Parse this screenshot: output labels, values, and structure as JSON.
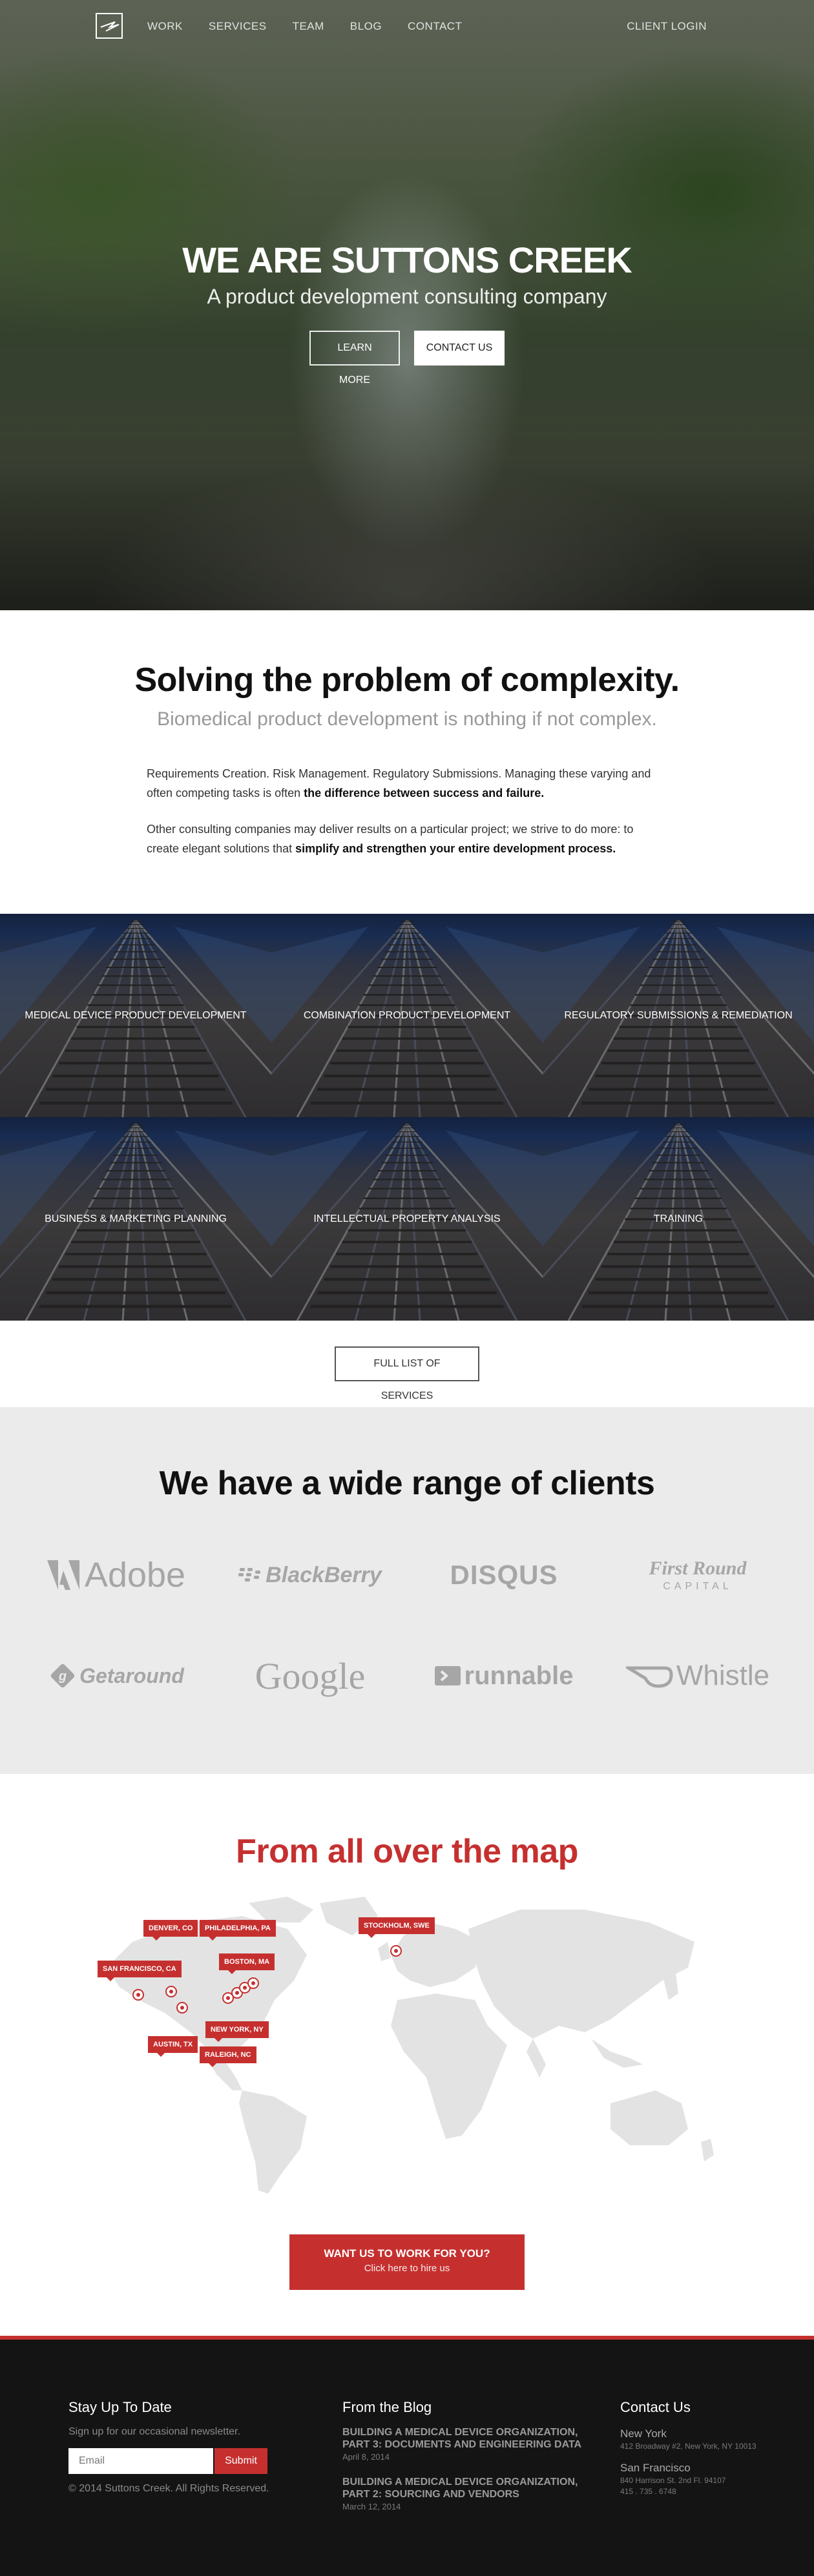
{
  "nav": {
    "links": [
      "WORK",
      "SERVICES",
      "TEAM",
      "BLOG",
      "CONTACT"
    ],
    "login": "CLIENT LOGIN"
  },
  "hero": {
    "title": "WE ARE SUTTONS CREEK",
    "subtitle": "A product development consulting company",
    "learn_more": "LEARN MORE",
    "contact_us": "CONTACT US"
  },
  "intro": {
    "heading": "Solving the problem of complexity.",
    "lead": "Biomedical product development is nothing if not complex.",
    "p1_text": "Requirements Creation. Risk Management. Regulatory Submissions. Managing these varying and often competing tasks is often ",
    "p1_bold": "the difference between success and failure.",
    "p2_text": "Other consulting companies may deliver results on a particular project; we strive to do more: to create elegant solutions that ",
    "p2_bold": "simplify and strengthen your entire development process."
  },
  "services": {
    "tiles": [
      "MEDICAL DEVICE PRODUCT DEVELOPMENT",
      "COMBINATION PRODUCT DEVELOPMENT",
      "REGULATORY SUBMISSIONS & REMEDIATION",
      "BUSINESS & MARKETING PLANNING",
      "INTELLECTUAL PROPERTY ANALYSIS",
      "TRAINING"
    ],
    "full_list": "FULL LIST OF SERVICES"
  },
  "clients": {
    "heading": "We have a wide range of clients",
    "logos": [
      "Adobe",
      "BlackBerry",
      "DISQUS",
      "First Round",
      "CAPITAL",
      "Getaround",
      "Google",
      "runnable",
      "Whistle"
    ],
    "logo_color": "#a6a6a6"
  },
  "map": {
    "heading": "From all over the map",
    "pins": [
      "DENVER, CO",
      "PHILADELPHIA, PA",
      "SAN FRANCISCO, CA",
      "BOSTON, MA",
      "NEW YORK, NY",
      "AUSTIN, TX",
      "RALEIGH, NC",
      "STOCKHOLM, SWE"
    ],
    "cta_title": "WANT US TO WORK FOR YOU?",
    "cta_sub": "Click here to hire us",
    "accent": "#c5302f"
  },
  "footer": {
    "newsletter": {
      "title": "Stay Up To Date",
      "text": "Sign up for our occasional newsletter.",
      "placeholder": "Email",
      "submit": "Submit",
      "copyright": "© 2014 Suttons Creek. All Rights Reserved."
    },
    "blog": {
      "title": "From the Blog",
      "posts": [
        {
          "title": "BUILDING A MEDICAL DEVICE ORGANIZATION, PART 3: DOCUMENTS AND ENGINEERING DATA",
          "date": "April 8, 2014"
        },
        {
          "title": "BUILDING A MEDICAL DEVICE ORGANIZATION, PART 2: SOURCING AND VENDORS",
          "date": "March 12, 2014"
        }
      ]
    },
    "contact": {
      "title": "Contact Us",
      "offices": [
        {
          "city": "New York",
          "address": "412 Broadway #2, New York, NY 10013"
        },
        {
          "city": "San Francisco",
          "address": "840 Harrison St. 2nd Fl. 94107",
          "phone": "415 . 735 . 6748"
        }
      ]
    }
  }
}
